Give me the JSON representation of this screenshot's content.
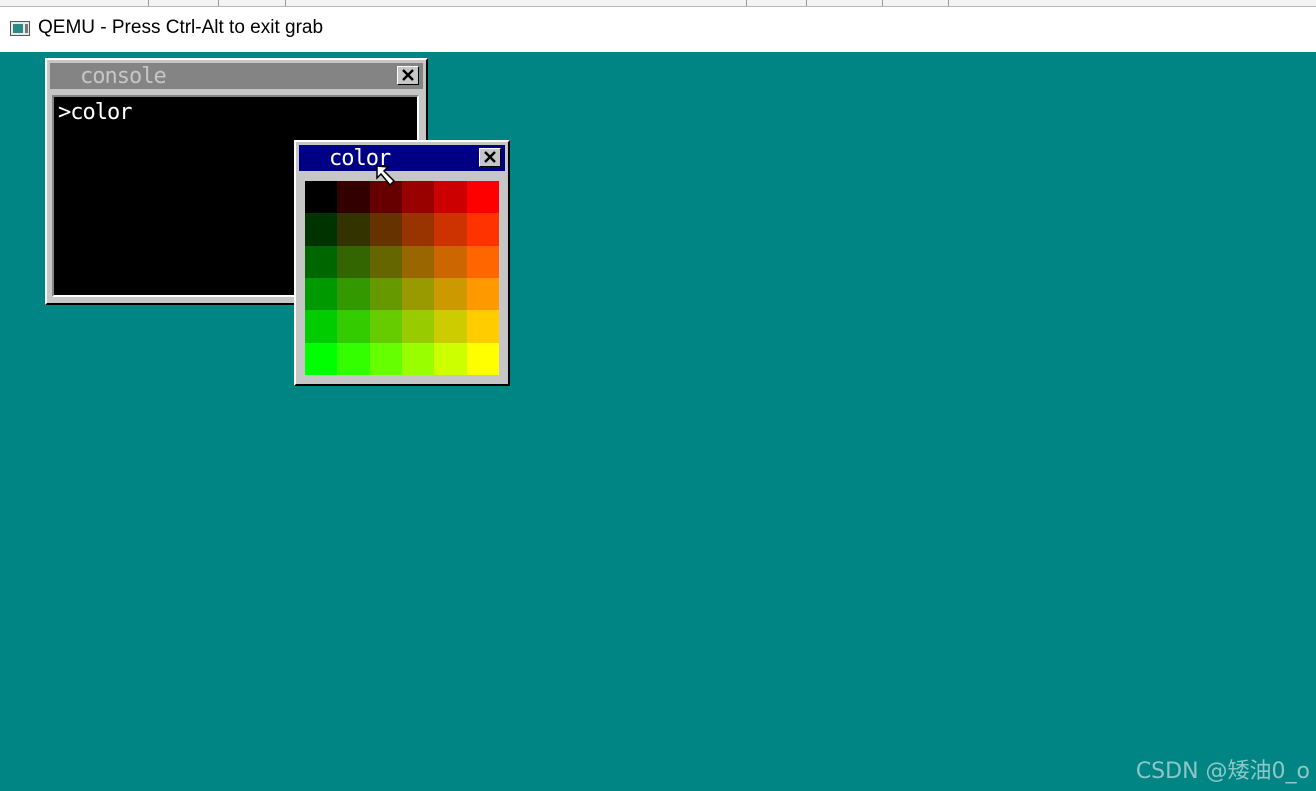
{
  "window": {
    "title": "QEMU - Press Ctrl-Alt to exit grab",
    "icon": "qemu-app-icon"
  },
  "desktop": {
    "background": "#008484",
    "watermark": "CSDN @矮油0_o"
  },
  "console_window": {
    "title": "console",
    "title_bar_color": "#848484",
    "title_text_color": "#c6c6c6",
    "text": ">color",
    "close_icon": "close-icon"
  },
  "color_window": {
    "title": "color",
    "title_bar_color": "#000084",
    "title_text_color": "#ffffff",
    "close_icon": "close-icon",
    "swatches": [
      [
        "#000000",
        "#330000",
        "#660000",
        "#990000",
        "#cc0000",
        "#ff0000"
      ],
      [
        "#003300",
        "#333300",
        "#663300",
        "#993300",
        "#cc3300",
        "#ff3300"
      ],
      [
        "#006600",
        "#336600",
        "#666600",
        "#996600",
        "#cc6600",
        "#ff6600"
      ],
      [
        "#009900",
        "#339900",
        "#669900",
        "#999900",
        "#cc9900",
        "#ff9900"
      ],
      [
        "#00cc00",
        "#33cc00",
        "#66cc00",
        "#99cc00",
        "#cccc00",
        "#ffcc00"
      ],
      [
        "#00ff00",
        "#33ff00",
        "#66ff00",
        "#99ff00",
        "#ccff00",
        "#ffff00"
      ]
    ]
  },
  "cursor": {
    "icon": "mouse-pointer-icon"
  }
}
